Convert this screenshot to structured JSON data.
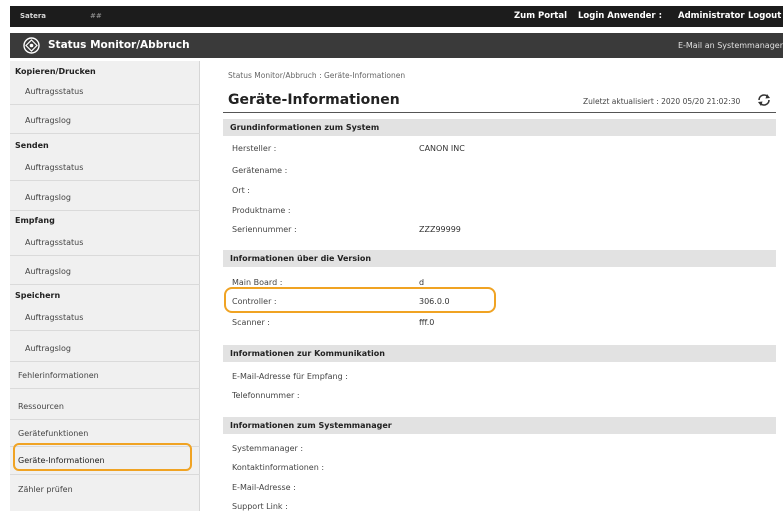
{
  "topbar": {
    "brand_left": "Satera",
    "brand_right": "##",
    "portal": "Zum Portal",
    "login_user": "Login Anwender :",
    "admin": "Administrator",
    "logout": "Logout"
  },
  "titlebar": {
    "title": "Status Monitor/Abbruch",
    "email_link": "E-Mail an Systemmanager"
  },
  "sidebar": {
    "groups": [
      {
        "heading": "Kopieren/Drucken",
        "items": [
          "Auftragsstatus",
          "Auftragslog"
        ]
      },
      {
        "heading": "Senden",
        "items": [
          "Auftragsstatus",
          "Auftragslog"
        ]
      },
      {
        "heading": "Empfang",
        "items": [
          "Auftragsstatus",
          "Auftragslog"
        ]
      },
      {
        "heading": "Speichern",
        "items": [
          "Auftragsstatus",
          "Auftragslog"
        ]
      }
    ],
    "extra_items": [
      "Fehlerinformationen",
      "Ressourcen",
      "Gerätefunktionen",
      "Geräte-Informationen",
      "Zähler prüfen"
    ]
  },
  "main": {
    "breadcrumb": "Status Monitor/Abbruch : Geräte-Informationen",
    "title": "Geräte-Informationen",
    "updated": "Zuletzt aktualisiert : 2020 05/20 21:02:30",
    "sections": [
      {
        "title": "Grundinformationen zum System",
        "rows": [
          {
            "label": "Hersteller :",
            "value": "CANON INC"
          },
          {
            "label": "Gerätename :",
            "value": ""
          },
          {
            "label": "Ort :",
            "value": ""
          },
          {
            "label": "Produktname :",
            "value": ""
          },
          {
            "label": "Seriennummer :",
            "value": "ZZZ99999"
          }
        ]
      },
      {
        "title": "Informationen über die Version",
        "rows": [
          {
            "label": "Main Board :",
            "value": "d"
          },
          {
            "label": "Controller :",
            "value": "306.0.0"
          },
          {
            "label": "Scanner :",
            "value": "fff.0"
          }
        ]
      },
      {
        "title": "Informationen zur Kommunikation",
        "rows": [
          {
            "label": "E-Mail-Adresse für Empfang :",
            "value": ""
          },
          {
            "label": "Telefonnummer :",
            "value": ""
          }
        ]
      },
      {
        "title": "Informationen zum Systemmanager",
        "rows": [
          {
            "label": "Systemmanager :",
            "value": ""
          },
          {
            "label": "Kontaktinformationen :",
            "value": ""
          },
          {
            "label": "E-Mail-Adresse :",
            "value": ""
          },
          {
            "label": "Support Link :",
            "value": ""
          }
        ]
      }
    ]
  },
  "colors": {
    "highlight": "#f0a323",
    "topbar": "#1c1c1c",
    "titlebar": "#3a3a3a",
    "section": "#e2e2e2"
  }
}
